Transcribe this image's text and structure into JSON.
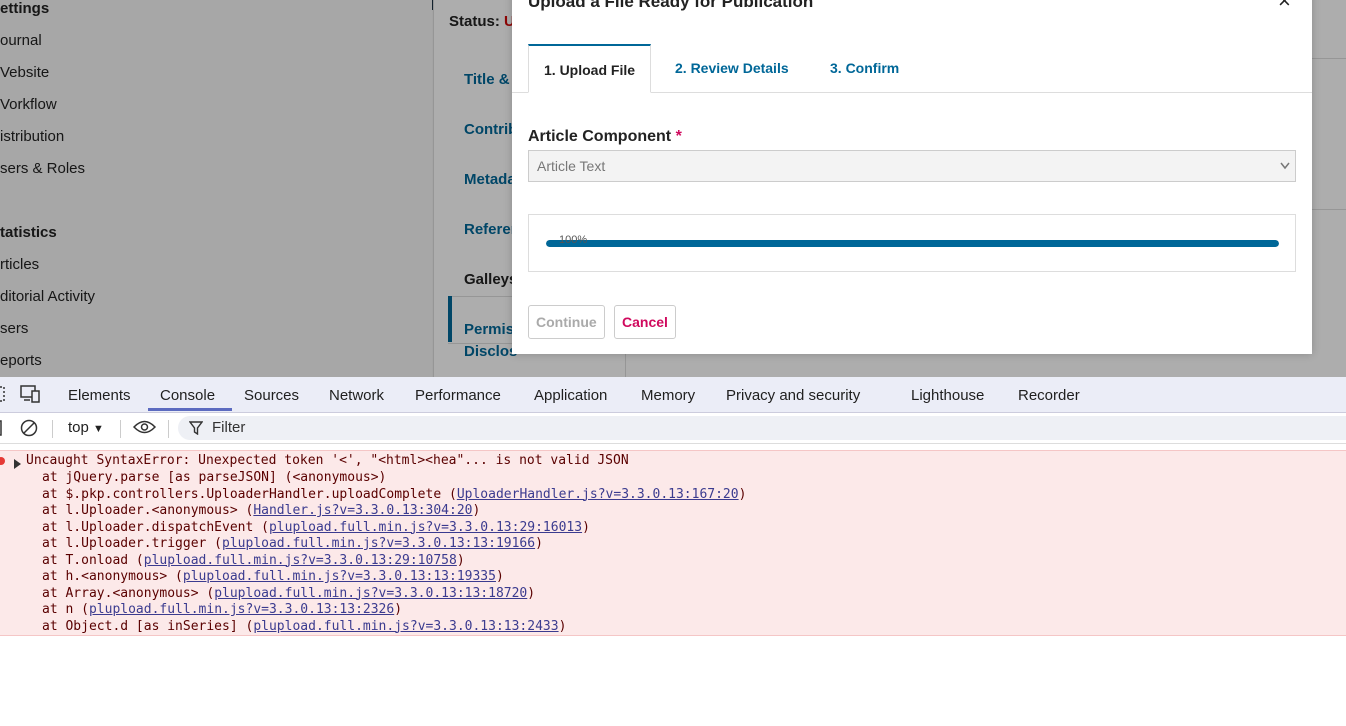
{
  "background_page": {
    "sidebar": {
      "settings_heading": "ettings",
      "settings_items": [
        "ournal",
        "Vebsite",
        "Vorkflow",
        "istribution",
        "sers & Roles"
      ],
      "statistics_heading": "tatistics",
      "statistics_items": [
        "rticles",
        "ditorial Activity",
        "sers",
        "eports"
      ]
    },
    "status_label": "Status:",
    "status_value": "U",
    "publication_tabs": [
      "Title &",
      "Contrib",
      "Metada",
      "Referen",
      "Galleys",
      "Permis",
      "Disclos"
    ]
  },
  "modal": {
    "title": "Upload a File Ready for Publication",
    "close_glyph": "×",
    "tabs": [
      {
        "label": "1. Upload File",
        "active": true
      },
      {
        "label": "2. Review Details",
        "active": false
      },
      {
        "label": "3. Confirm",
        "active": false
      }
    ],
    "component_label": "Article Component",
    "required_marker": "*",
    "component_select": {
      "selected": "Article Text"
    },
    "upload": {
      "progress": 1.0,
      "progress_text": "100%"
    },
    "buttons": {
      "continue": "Continue",
      "cancel": "Cancel"
    }
  },
  "devtools": {
    "tabs": [
      "Elements",
      "Console",
      "Sources",
      "Network",
      "Performance",
      "Application",
      "Memory",
      "Privacy and security",
      "Lighthouse",
      "Recorder"
    ],
    "active_tab": "Console",
    "toolbar": {
      "context": "top",
      "filter_placeholder": "Filter"
    },
    "error": {
      "message": "Uncaught SyntaxError: Unexpected token '<', \"<html><hea\"... is not valid JSON",
      "stack": [
        {
          "text": "at jQuery.parse [as parseJSON] (<anonymous>)",
          "link": "",
          "suffix": ""
        },
        {
          "text": "at $.pkp.controllers.UploaderHandler.uploadComplete (",
          "link": "UploaderHandler.js?v=3.3.0.13:167:20",
          "suffix": ")"
        },
        {
          "text": "at l.Uploader.<anonymous> (",
          "link": "Handler.js?v=3.3.0.13:304:20",
          "suffix": ")"
        },
        {
          "text": "at l.Uploader.dispatchEvent (",
          "link": "plupload.full.min.js?v=3.3.0.13:29:16013",
          "suffix": ")"
        },
        {
          "text": "at l.Uploader.trigger (",
          "link": "plupload.full.min.js?v=3.3.0.13:13:19166",
          "suffix": ")"
        },
        {
          "text": "at T.onload (",
          "link": "plupload.full.min.js?v=3.3.0.13:29:10758",
          "suffix": ")"
        },
        {
          "text": "at h.<anonymous> (",
          "link": "plupload.full.min.js?v=3.3.0.13:13:19335",
          "suffix": ")"
        },
        {
          "text": "at Array.<anonymous> (",
          "link": "plupload.full.min.js?v=3.3.0.13:13:18720",
          "suffix": ")"
        },
        {
          "text": "at n (",
          "link": "plupload.full.min.js?v=3.3.0.13:13:2326",
          "suffix": ")"
        },
        {
          "text": "at Object.d [as inSeries] (",
          "link": "plupload.full.min.js?v=3.3.0.13:13:2433",
          "suffix": ")"
        }
      ]
    }
  },
  "colors": {
    "accent": "#006798",
    "danger": "#d00a5e",
    "devtools_active": "#5c6bc0",
    "error_bg": "#fce9e9"
  }
}
